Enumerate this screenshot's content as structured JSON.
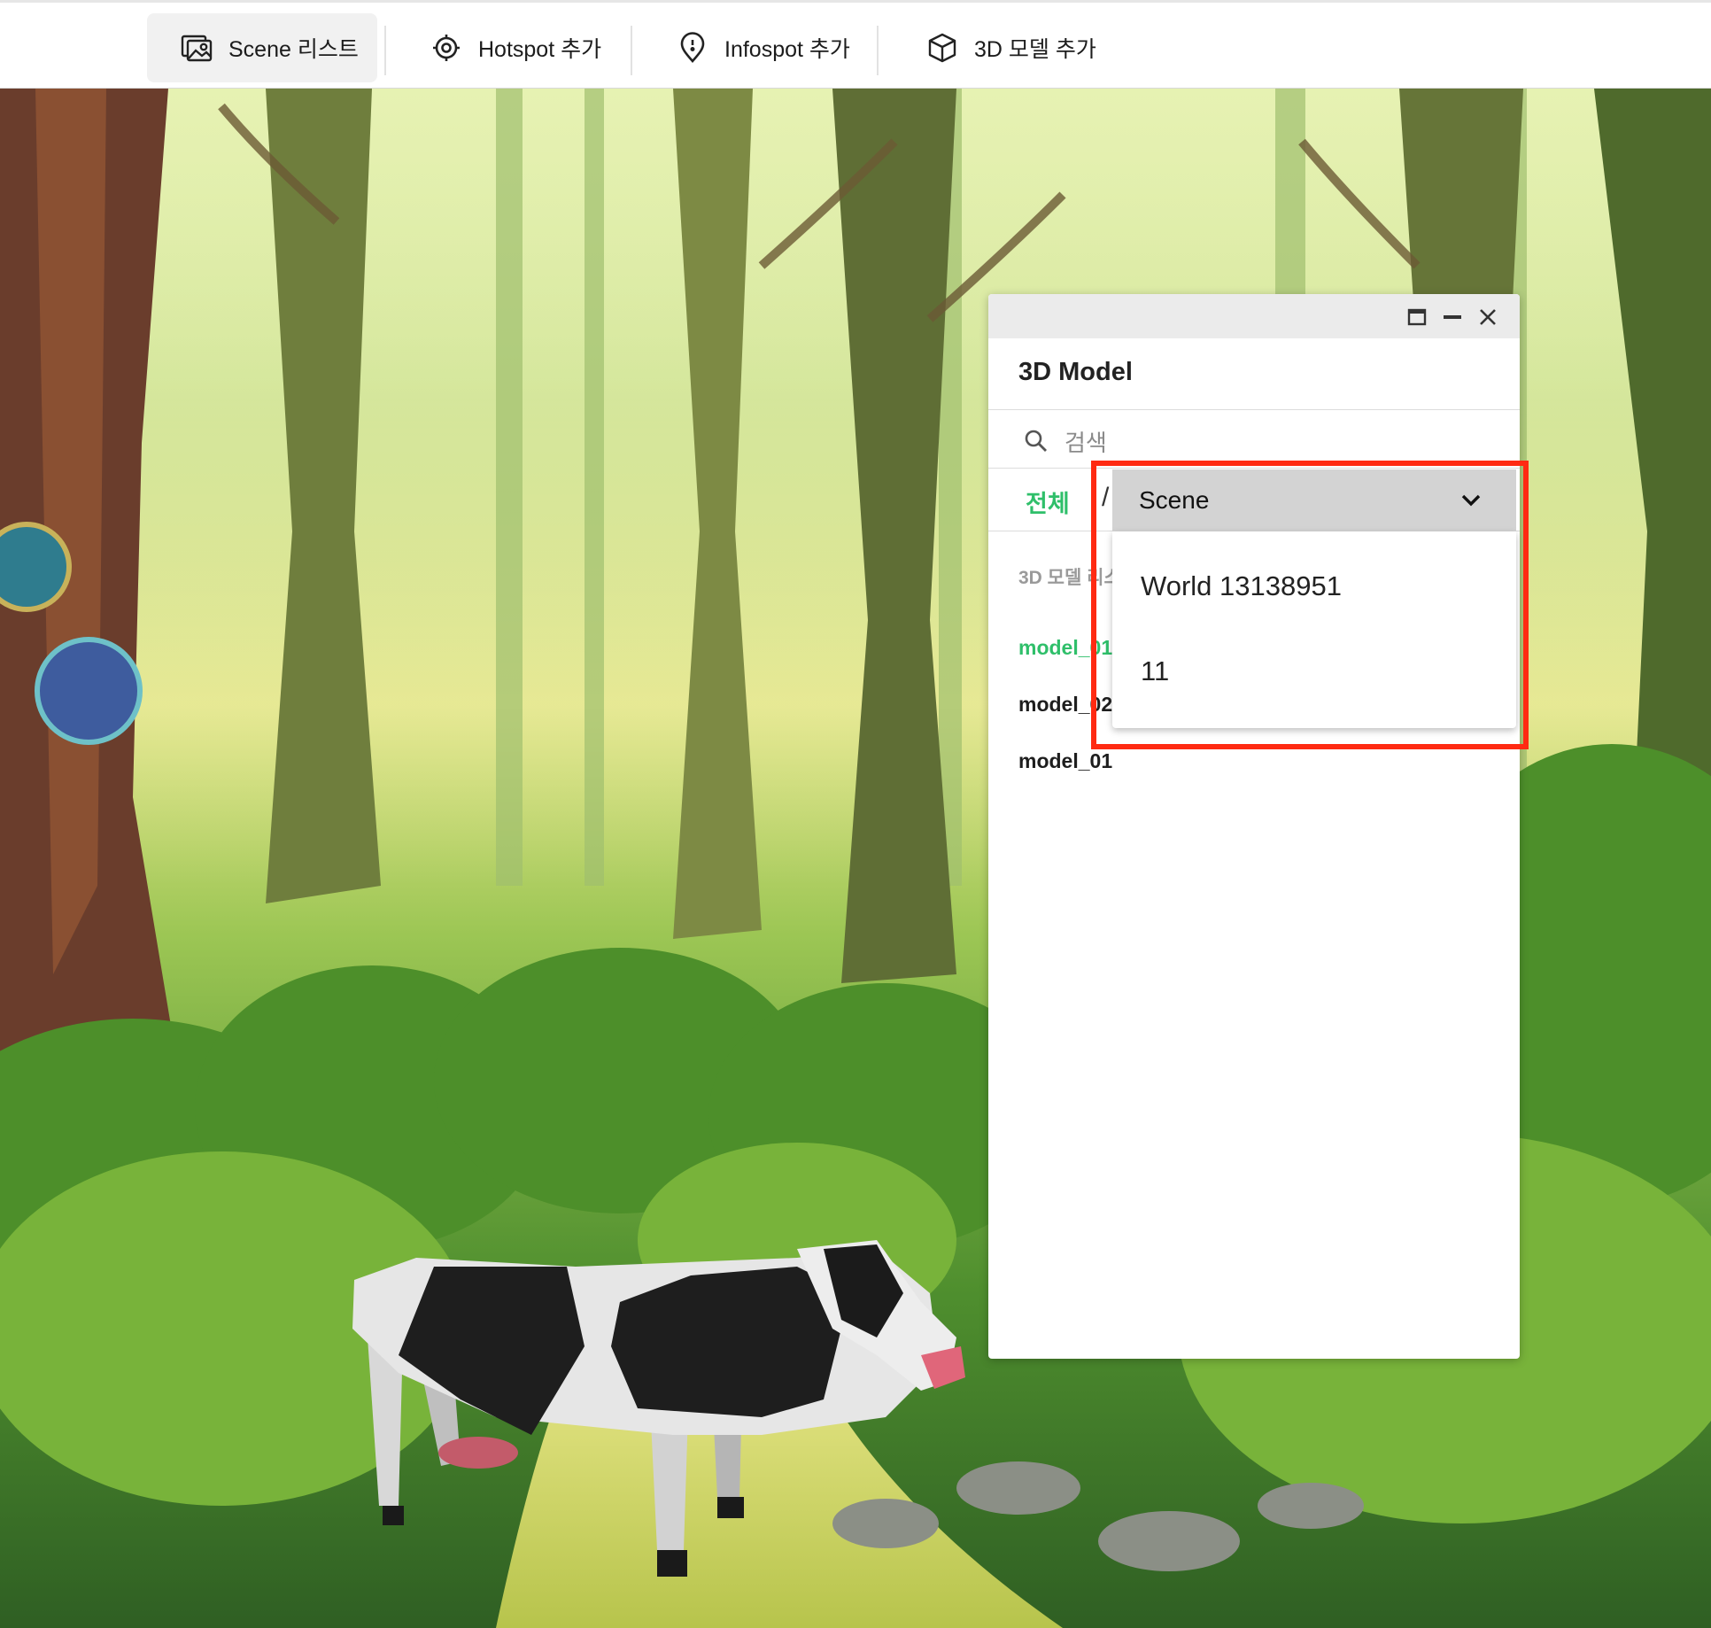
{
  "toolbar": {
    "tabs": [
      {
        "label": "Scene 리스트",
        "icon": "image-list-icon",
        "active": true
      },
      {
        "label": "Hotspot 추가",
        "icon": "target-icon",
        "active": false
      },
      {
        "label": "Infospot 추가",
        "icon": "map-pin-icon",
        "active": false
      },
      {
        "label": "3D 모델 추가",
        "icon": "cube-icon",
        "active": false
      }
    ]
  },
  "panel": {
    "title": "3D Model",
    "window_controls": [
      "maximize-icon",
      "minimize-icon",
      "close-icon"
    ],
    "search": {
      "placeholder": "검색",
      "value": ""
    },
    "filter": {
      "all_label": "전체",
      "separator": "/"
    },
    "list_label": "3D 모델 리스트",
    "models": [
      {
        "name": "model_01",
        "selected": true
      },
      {
        "name": "model_02",
        "selected": false
      },
      {
        "name": "model_01",
        "selected": false
      }
    ]
  },
  "dropdown": {
    "selected": "Scene",
    "options": [
      "World 13138951",
      "11"
    ]
  },
  "colors": {
    "accent_green": "#2fbf6a",
    "highlight_red": "#ff2a12",
    "dropdown_header": "#d3d3d3"
  }
}
